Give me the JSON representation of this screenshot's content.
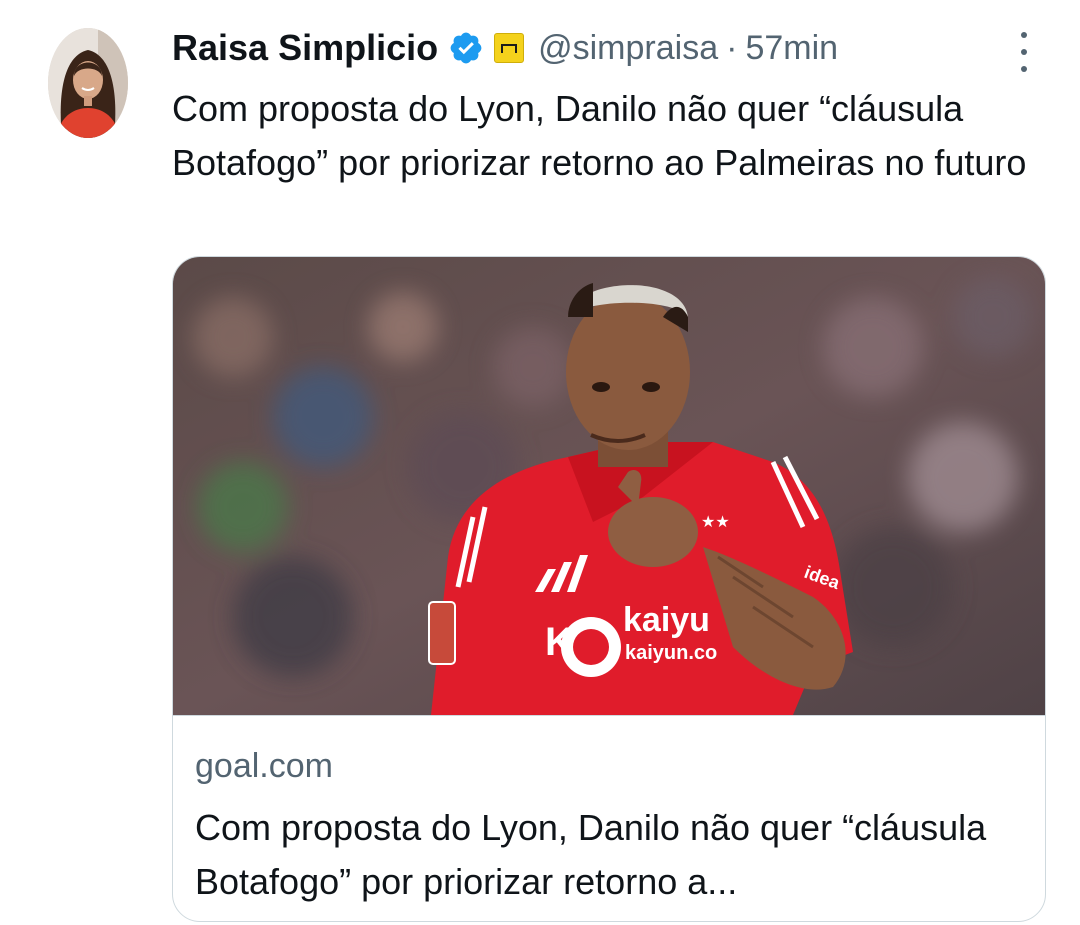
{
  "tweet": {
    "author_name": "Raisa Simplicio",
    "handle": "@simpraisa",
    "separator": "·",
    "time_ago": "57min",
    "text": "Com proposta do Lyon, Danilo não quer “cláusula Botafogo” por priorizar retorno ao Palmeiras no futuro"
  },
  "card": {
    "domain": "goal.com",
    "title": "Com proposta do Lyon, Danilo não quer “cláusula Botafogo” por priorizar retorno a...",
    "jersey_sponsor": "kaiyu",
    "jersey_sponsor_url": "kaiyun.co",
    "jersey_side_text": "idea"
  },
  "icons": {
    "verified": "verified-badge-icon",
    "org": "goal-org-badge-icon",
    "more": "more-options-icon"
  },
  "colors": {
    "verified_blue": "#1d9bf0",
    "org_yellow": "#f4d21c",
    "secondary_text": "#536471",
    "primary_text": "#0f1419",
    "jersey_red": "#e01c2b"
  }
}
